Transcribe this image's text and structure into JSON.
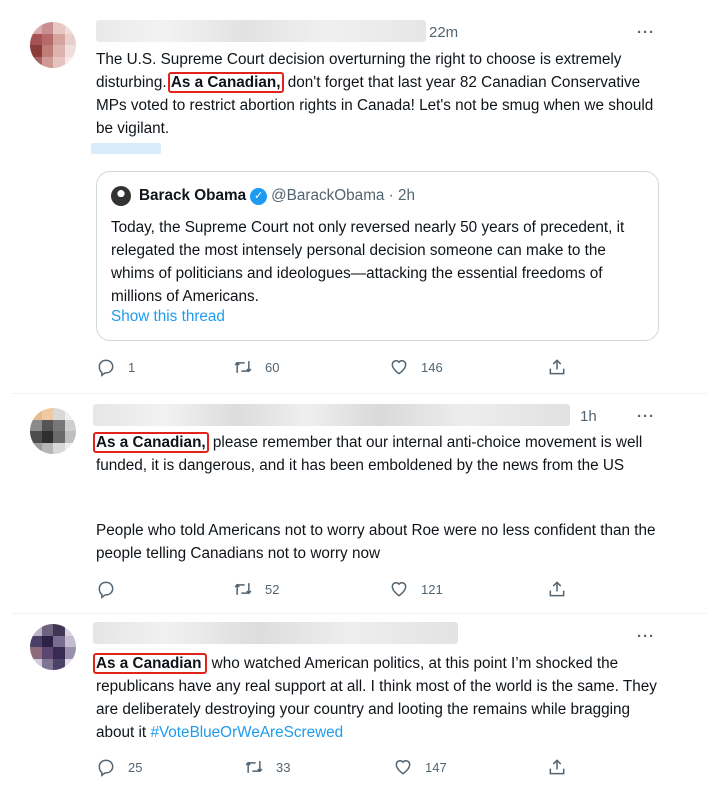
{
  "tweets": [
    {
      "time": "22m",
      "more": "···",
      "text_before": "The U.S. Supreme Court decision overturning the right to choose is extremely disturbing. ",
      "highlight": "As a Canadian,",
      "text_after": " don't forget that last year 82 Canadian Conservative MPs voted to restrict abortion rights in Canada! Let's not be smug when we should be vigilant.",
      "quote": {
        "name": "Barack Obama",
        "handle": "@BarackObama · 2h",
        "text": "Today, the Supreme Court not only reversed nearly 50 years of precedent, it relegated the most intensely personal decision someone can make to the whims of politicians and ideologues—attacking the essential freedoms of millions of Americans.",
        "link": "Show this thread"
      },
      "replies": "1",
      "retweets": "60",
      "likes": "146"
    },
    {
      "time": "1h",
      "more": "···",
      "highlight": "As a Canadian,",
      "text_after": " please remember that our internal anti-choice movement is well funded, it is dangerous, and it has been emboldened by the news from the US",
      "paragraph2": "People who told Americans not to worry about Roe were no less confident than the people telling Canadians not to worry now",
      "replies": "",
      "retweets": "52",
      "likes": "121"
    },
    {
      "time": "",
      "more": "···",
      "highlight": "As a Canadian",
      "text_after": " who watched American politics, at this point I’m shocked the republicans have any real support at all. I think most of the world is the same. They are deliberately destroying your country and looting the remains while bragging about it ",
      "hashtag": "#VoteBlueOrWeAreScrewed",
      "replies": "25",
      "retweets": "33",
      "likes": "147"
    }
  ],
  "icons": {
    "reply": "reply-icon",
    "retweet": "retweet-icon",
    "like": "heart-icon",
    "share": "share-icon",
    "verified": "verified-badge-icon"
  },
  "colors": {
    "accent": "#1d9bf0",
    "highlight_box": "#e0241b",
    "muted": "#536471",
    "border": "#cfd9de"
  }
}
